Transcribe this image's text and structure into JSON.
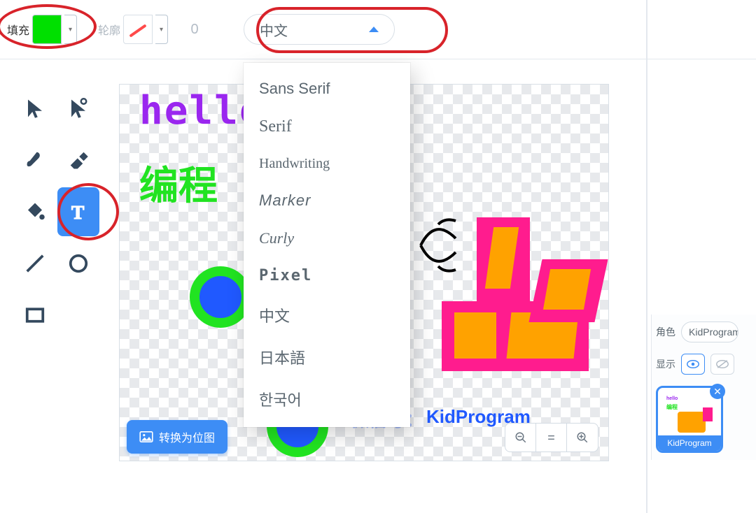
{
  "toolbar": {
    "fill_label": "填充",
    "fill_color": "#00e000",
    "outline_label": "轮廓",
    "stroke_width": "0",
    "font_selected": "中文"
  },
  "font_menu": {
    "items": [
      {
        "label": "Sans Serif",
        "cls": "f-sans"
      },
      {
        "label": "Serif",
        "cls": "f-serif"
      },
      {
        "label": "Handwriting",
        "cls": "f-hand"
      },
      {
        "label": "Marker",
        "cls": "f-marker"
      },
      {
        "label": "Curly",
        "cls": "f-curly"
      },
      {
        "label": "Pixel",
        "cls": "f-pixel"
      },
      {
        "label": "中文",
        "cls": ""
      },
      {
        "label": "日本語",
        "cls": ""
      },
      {
        "label": "한국어",
        "cls": ""
      }
    ]
  },
  "tools": [
    {
      "name": "select-tool"
    },
    {
      "name": "reshape-tool"
    },
    {
      "name": "brush-tool"
    },
    {
      "name": "eraser-tool"
    },
    {
      "name": "fill-tool"
    },
    {
      "name": "text-tool"
    },
    {
      "name": "line-tool"
    },
    {
      "name": "circle-tool"
    },
    {
      "name": "rect-tool"
    }
  ],
  "canvas": {
    "hello_text": "hello",
    "cn_text": "编程",
    "wx_prefix": "微信号：",
    "wx_name": "KidProgram"
  },
  "buttons": {
    "convert": "转换为位图",
    "zoom_reset": "="
  },
  "right_panel": {
    "role_label": "角色",
    "role_value": "KidProgram",
    "show_label": "显示",
    "thumb_label": "KidProgram"
  }
}
